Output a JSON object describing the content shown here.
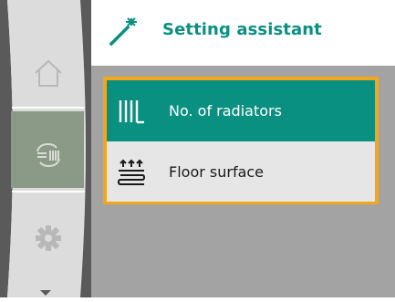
{
  "header": {
    "title": "Setting assistant",
    "icon": "magic-wand-icon"
  },
  "nav": {
    "items": [
      {
        "name": "home",
        "icon": "home-icon",
        "active": false
      },
      {
        "name": "control-mode",
        "icon": "control-mode-icon",
        "active": true
      },
      {
        "name": "settings",
        "icon": "gear-icon",
        "active": false
      }
    ],
    "scroll_icon": "chevron-down-icon"
  },
  "menu": {
    "items": [
      {
        "label": "No. of radiators",
        "icon": "radiator-icon",
        "selected": true
      },
      {
        "label": "Floor surface",
        "icon": "floor-heating-icon",
        "selected": false
      }
    ]
  },
  "colors": {
    "accent": "#0a9080",
    "highlight_border": "#f4a619",
    "content_bg": "#a3a3a3",
    "nav_bg": "#5a5a5a",
    "nav_active": "#8a9a86"
  }
}
